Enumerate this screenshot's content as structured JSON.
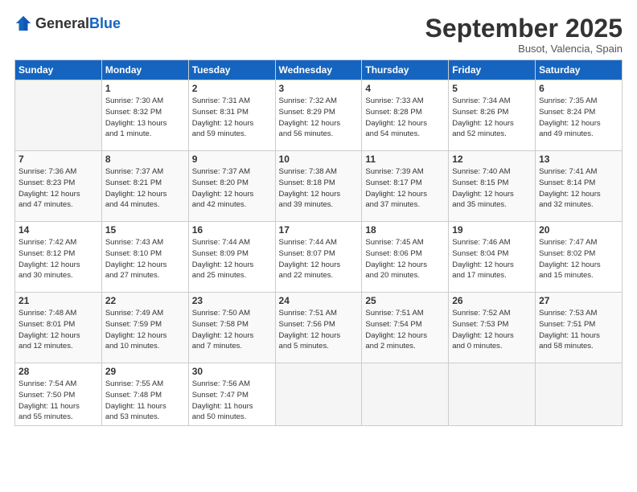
{
  "header": {
    "logo_general": "General",
    "logo_blue": "Blue",
    "month": "September 2025",
    "location": "Busot, Valencia, Spain"
  },
  "weekdays": [
    "Sunday",
    "Monday",
    "Tuesday",
    "Wednesday",
    "Thursday",
    "Friday",
    "Saturday"
  ],
  "rows": [
    [
      {
        "day": "",
        "info": ""
      },
      {
        "day": "1",
        "info": "Sunrise: 7:30 AM\nSunset: 8:32 PM\nDaylight: 13 hours\nand 1 minute."
      },
      {
        "day": "2",
        "info": "Sunrise: 7:31 AM\nSunset: 8:31 PM\nDaylight: 12 hours\nand 59 minutes."
      },
      {
        "day": "3",
        "info": "Sunrise: 7:32 AM\nSunset: 8:29 PM\nDaylight: 12 hours\nand 56 minutes."
      },
      {
        "day": "4",
        "info": "Sunrise: 7:33 AM\nSunset: 8:28 PM\nDaylight: 12 hours\nand 54 minutes."
      },
      {
        "day": "5",
        "info": "Sunrise: 7:34 AM\nSunset: 8:26 PM\nDaylight: 12 hours\nand 52 minutes."
      },
      {
        "day": "6",
        "info": "Sunrise: 7:35 AM\nSunset: 8:24 PM\nDaylight: 12 hours\nand 49 minutes."
      }
    ],
    [
      {
        "day": "7",
        "info": "Sunrise: 7:36 AM\nSunset: 8:23 PM\nDaylight: 12 hours\nand 47 minutes."
      },
      {
        "day": "8",
        "info": "Sunrise: 7:37 AM\nSunset: 8:21 PM\nDaylight: 12 hours\nand 44 minutes."
      },
      {
        "day": "9",
        "info": "Sunrise: 7:37 AM\nSunset: 8:20 PM\nDaylight: 12 hours\nand 42 minutes."
      },
      {
        "day": "10",
        "info": "Sunrise: 7:38 AM\nSunset: 8:18 PM\nDaylight: 12 hours\nand 39 minutes."
      },
      {
        "day": "11",
        "info": "Sunrise: 7:39 AM\nSunset: 8:17 PM\nDaylight: 12 hours\nand 37 minutes."
      },
      {
        "day": "12",
        "info": "Sunrise: 7:40 AM\nSunset: 8:15 PM\nDaylight: 12 hours\nand 35 minutes."
      },
      {
        "day": "13",
        "info": "Sunrise: 7:41 AM\nSunset: 8:14 PM\nDaylight: 12 hours\nand 32 minutes."
      }
    ],
    [
      {
        "day": "14",
        "info": "Sunrise: 7:42 AM\nSunset: 8:12 PM\nDaylight: 12 hours\nand 30 minutes."
      },
      {
        "day": "15",
        "info": "Sunrise: 7:43 AM\nSunset: 8:10 PM\nDaylight: 12 hours\nand 27 minutes."
      },
      {
        "day": "16",
        "info": "Sunrise: 7:44 AM\nSunset: 8:09 PM\nDaylight: 12 hours\nand 25 minutes."
      },
      {
        "day": "17",
        "info": "Sunrise: 7:44 AM\nSunset: 8:07 PM\nDaylight: 12 hours\nand 22 minutes."
      },
      {
        "day": "18",
        "info": "Sunrise: 7:45 AM\nSunset: 8:06 PM\nDaylight: 12 hours\nand 20 minutes."
      },
      {
        "day": "19",
        "info": "Sunrise: 7:46 AM\nSunset: 8:04 PM\nDaylight: 12 hours\nand 17 minutes."
      },
      {
        "day": "20",
        "info": "Sunrise: 7:47 AM\nSunset: 8:02 PM\nDaylight: 12 hours\nand 15 minutes."
      }
    ],
    [
      {
        "day": "21",
        "info": "Sunrise: 7:48 AM\nSunset: 8:01 PM\nDaylight: 12 hours\nand 12 minutes."
      },
      {
        "day": "22",
        "info": "Sunrise: 7:49 AM\nSunset: 7:59 PM\nDaylight: 12 hours\nand 10 minutes."
      },
      {
        "day": "23",
        "info": "Sunrise: 7:50 AM\nSunset: 7:58 PM\nDaylight: 12 hours\nand 7 minutes."
      },
      {
        "day": "24",
        "info": "Sunrise: 7:51 AM\nSunset: 7:56 PM\nDaylight: 12 hours\nand 5 minutes."
      },
      {
        "day": "25",
        "info": "Sunrise: 7:51 AM\nSunset: 7:54 PM\nDaylight: 12 hours\nand 2 minutes."
      },
      {
        "day": "26",
        "info": "Sunrise: 7:52 AM\nSunset: 7:53 PM\nDaylight: 12 hours\nand 0 minutes."
      },
      {
        "day": "27",
        "info": "Sunrise: 7:53 AM\nSunset: 7:51 PM\nDaylight: 11 hours\nand 58 minutes."
      }
    ],
    [
      {
        "day": "28",
        "info": "Sunrise: 7:54 AM\nSunset: 7:50 PM\nDaylight: 11 hours\nand 55 minutes."
      },
      {
        "day": "29",
        "info": "Sunrise: 7:55 AM\nSunset: 7:48 PM\nDaylight: 11 hours\nand 53 minutes."
      },
      {
        "day": "30",
        "info": "Sunrise: 7:56 AM\nSunset: 7:47 PM\nDaylight: 11 hours\nand 50 minutes."
      },
      {
        "day": "",
        "info": ""
      },
      {
        "day": "",
        "info": ""
      },
      {
        "day": "",
        "info": ""
      },
      {
        "day": "",
        "info": ""
      }
    ]
  ]
}
